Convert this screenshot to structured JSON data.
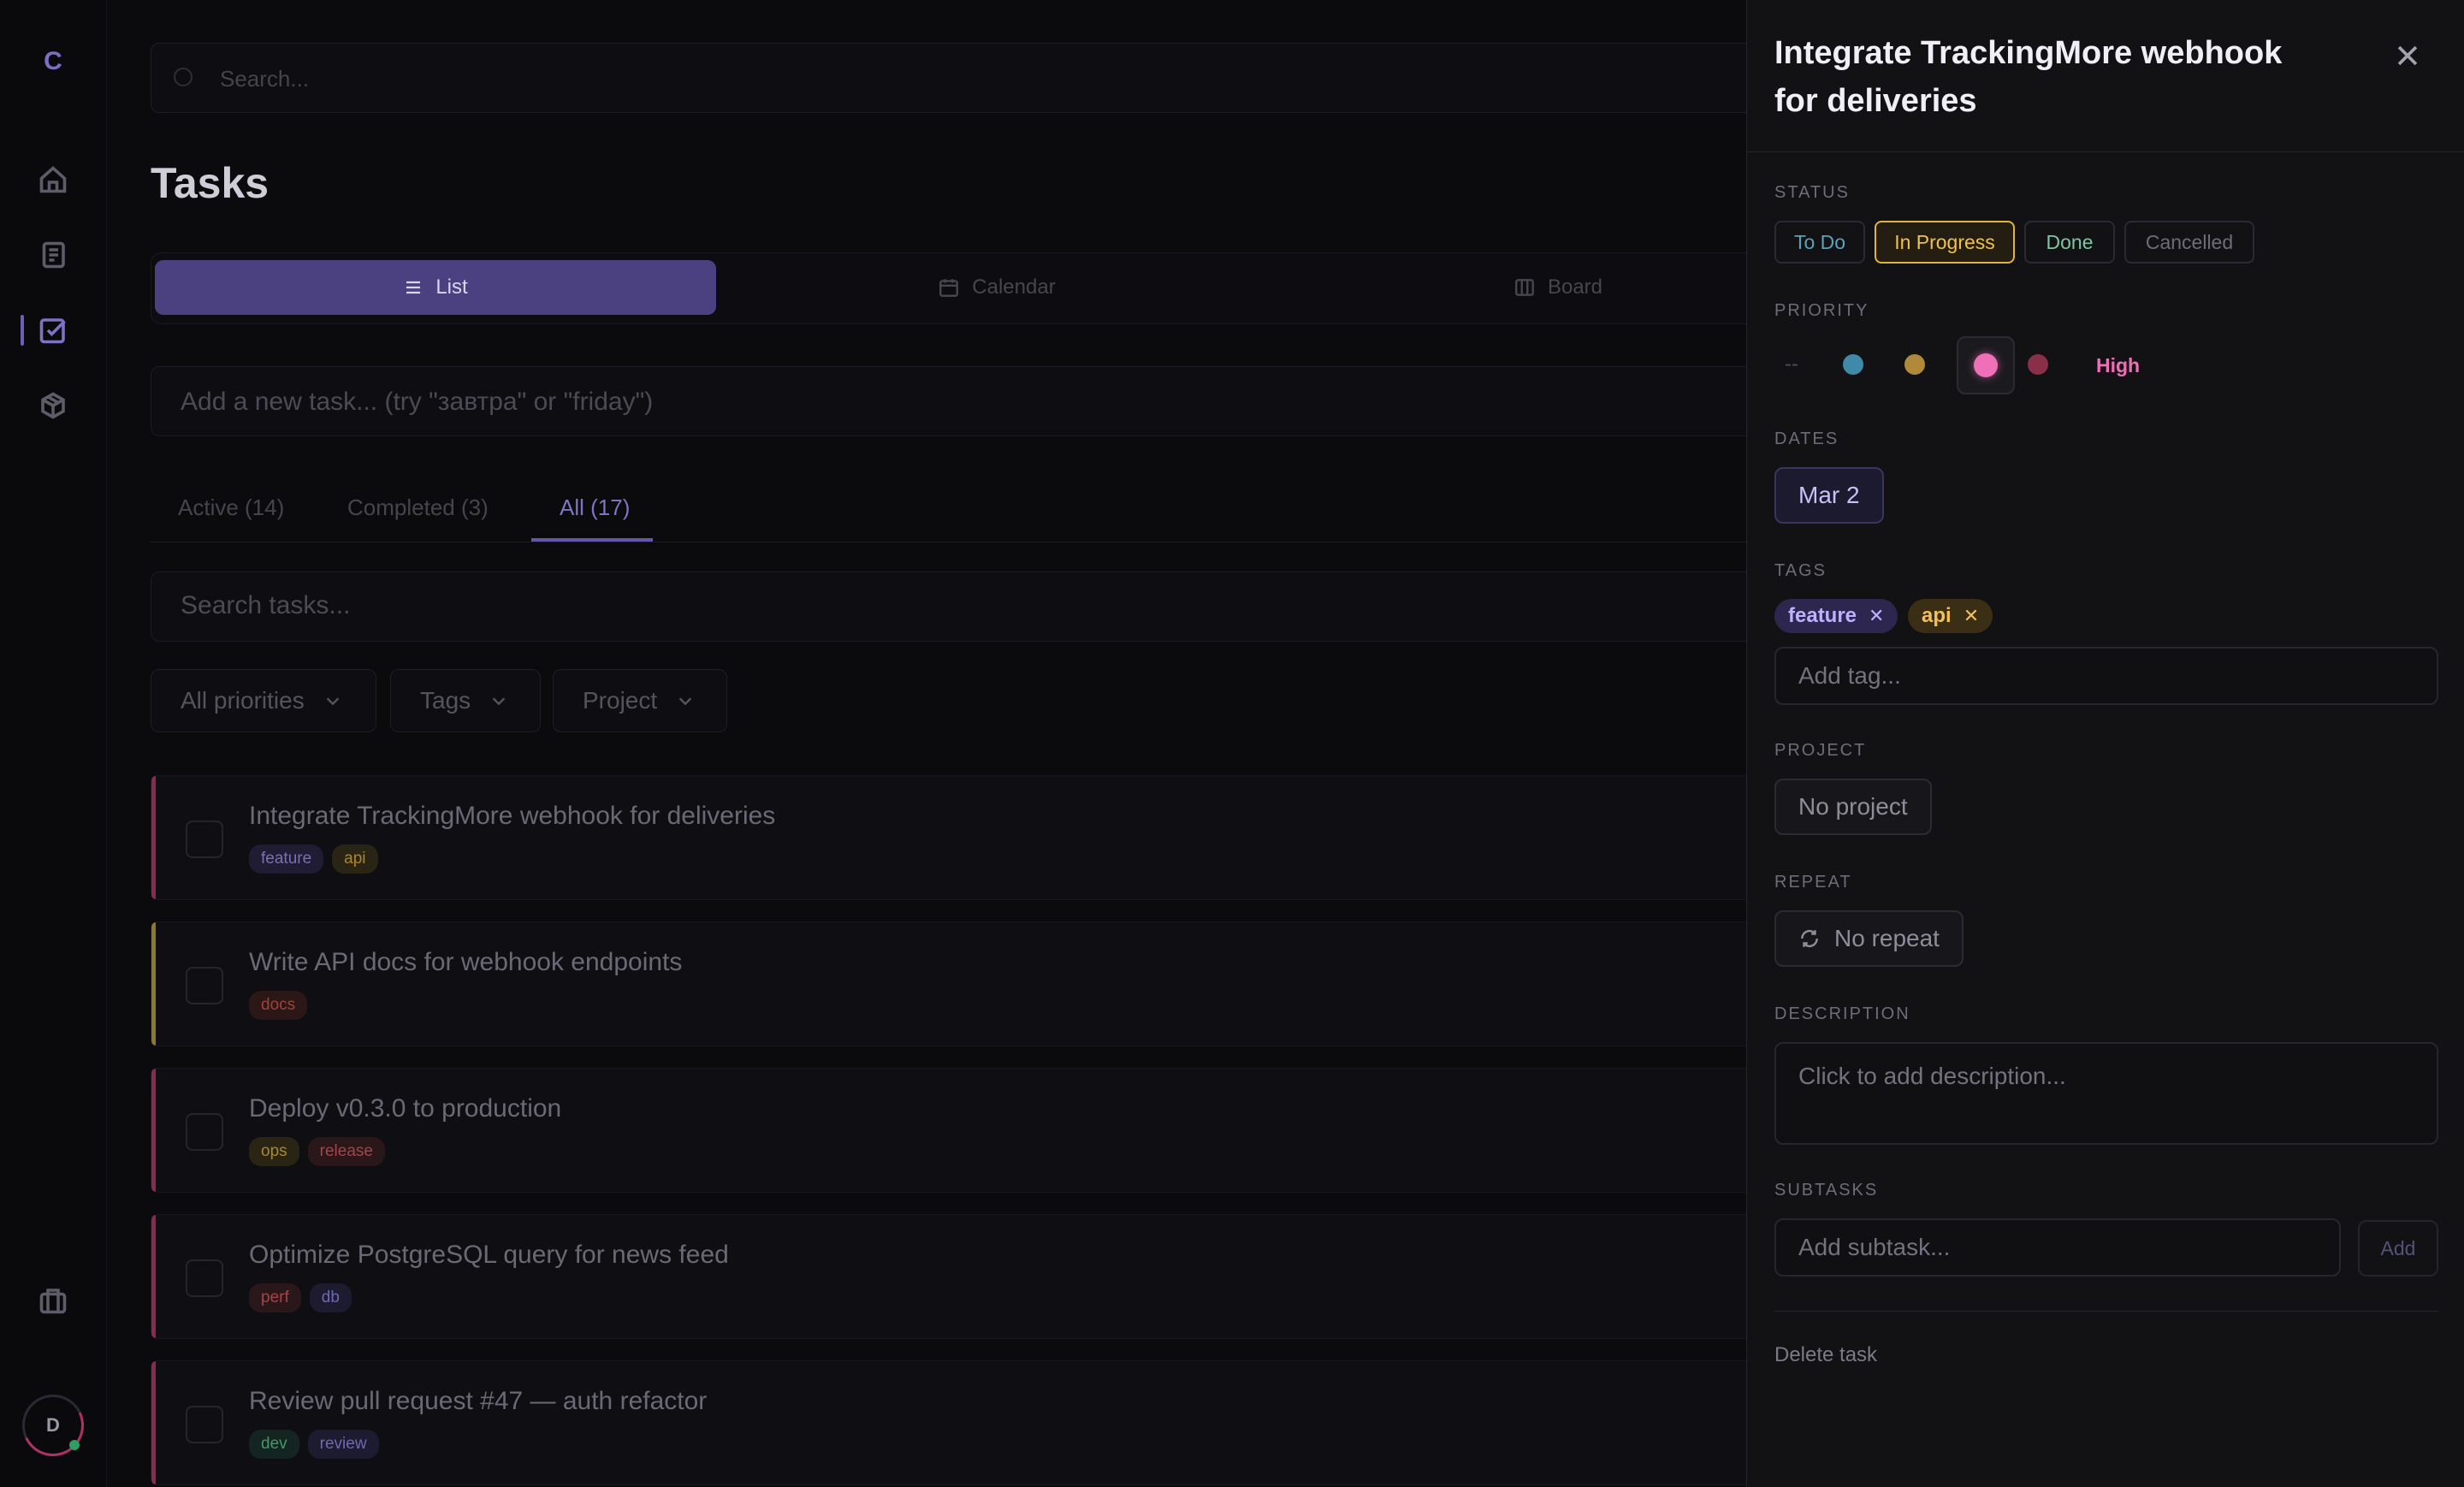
{
  "rail": {
    "logo": "C",
    "avatar_initial": "D",
    "icons": [
      "home-icon",
      "notes-icon",
      "tasks-icon",
      "package-icon",
      "archive-icon"
    ]
  },
  "main": {
    "search_placeholder": "Search...",
    "title": "Tasks",
    "views": [
      {
        "label": "List",
        "icon": "list-icon",
        "active": true
      },
      {
        "label": "Calendar",
        "icon": "calendar-icon",
        "active": false
      },
      {
        "label": "Board",
        "icon": "board-icon",
        "active": false
      }
    ],
    "add_task_placeholder": "Add a new task... (try \"завтра\" or \"friday\")",
    "tabs": [
      {
        "label": "Active (14)"
      },
      {
        "label": "Completed (3)"
      },
      {
        "label": "All (17)",
        "active": true
      }
    ],
    "search_tasks_placeholder": "Search tasks...",
    "filters": [
      {
        "label": "All priorities"
      },
      {
        "label": "Tags"
      },
      {
        "label": "Project"
      }
    ],
    "tasks": [
      {
        "name": "Integrate TrackingMore webhook for deliveries",
        "accent": "#8a2a4c",
        "tags": [
          {
            "label": "feature",
            "color": "#7a70b8",
            "bg": "#1f1c33"
          },
          {
            "label": "api",
            "color": "#a9872f",
            "bg": "#2a2415"
          }
        ]
      },
      {
        "name": "Write API docs for webhook endpoints",
        "accent": "#8a7a2a",
        "tags": [
          {
            "label": "docs",
            "color": "#a0423a",
            "bg": "#2a1716"
          }
        ]
      },
      {
        "name": "Deploy v0.3.0 to production",
        "accent": "#8a2a4c",
        "tags": [
          {
            "label": "ops",
            "color": "#a9872f",
            "bg": "#2a2415"
          },
          {
            "label": "release",
            "color": "#a8434a",
            "bg": "#2a1719"
          }
        ]
      },
      {
        "name": "Optimize PostgreSQL query for news feed",
        "accent": "#8a2a4c",
        "tags": [
          {
            "label": "perf",
            "color": "#a8434a",
            "bg": "#2a1719"
          },
          {
            "label": "db",
            "color": "#6d6ab2",
            "bg": "#1c1b30"
          }
        ]
      },
      {
        "name": "Review pull request #47 — auth refactor",
        "accent": "#8a2a4c",
        "tags": [
          {
            "label": "dev",
            "color": "#3f9a6a",
            "bg": "#142420"
          },
          {
            "label": "review",
            "color": "#6d6ab2",
            "bg": "#1c1b30"
          }
        ]
      }
    ]
  },
  "panel": {
    "title": "Integrate TrackingMore webhook for deliveries",
    "status_label": "STATUS",
    "statuses": [
      {
        "label": "To Do",
        "color": "#5aa3b8"
      },
      {
        "label": "In Progress",
        "color": "#f0c14b",
        "selected": true
      },
      {
        "label": "Done",
        "color": "#7fc6a0"
      },
      {
        "label": "Cancelled",
        "color": "#6e6c79"
      }
    ],
    "priority_label": "PRIORITY",
    "priority_none": "--",
    "priority_levels": [
      {
        "name": "low",
        "color": "#3f8aa8"
      },
      {
        "name": "medium",
        "color": "#b08a3a"
      },
      {
        "name": "high",
        "color": "#f070b8",
        "selected": true
      },
      {
        "name": "urgent",
        "color": "#8a2f4a"
      }
    ],
    "priority_value": "High",
    "dates_label": "DATES",
    "date": "Mar 2",
    "tags_label": "TAGS",
    "tags": [
      {
        "label": "feature",
        "color": "#bdb2ff",
        "bg": "#2d2750"
      },
      {
        "label": "api",
        "color": "#f2c05a",
        "bg": "#3a2e14"
      }
    ],
    "add_tag_placeholder": "Add tag...",
    "project_label": "PROJECT",
    "project": "No project",
    "repeat_label": "REPEAT",
    "repeat": "No repeat",
    "description_label": "DESCRIPTION",
    "description_placeholder": "Click to add description...",
    "subtasks_label": "SUBTASKS",
    "add_subtask_placeholder": "Add subtask...",
    "add_button": "Add",
    "delete_label": "Delete task"
  }
}
